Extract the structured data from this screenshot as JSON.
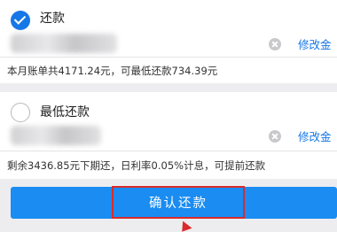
{
  "options": {
    "full": {
      "label": "还款",
      "selected": true,
      "edit_label": "修改金",
      "hint": "本月账单共4171.24元，可最低还款734.39元"
    },
    "minimum": {
      "label": "最低还款",
      "selected": false,
      "edit_label": "修改金",
      "hint": "剩余3436.85元下期还，日利率0.05%计息，可提前还款"
    }
  },
  "confirm": {
    "label": "确认还款"
  },
  "colors": {
    "accent": "#1677e6",
    "button": "#1a8cf2",
    "highlight": "#d92b2b"
  },
  "icons": {
    "checked": "check-circle-icon",
    "unchecked": "empty-circle-icon",
    "clear": "clear-icon",
    "pointer": "red-arrow-icon"
  }
}
